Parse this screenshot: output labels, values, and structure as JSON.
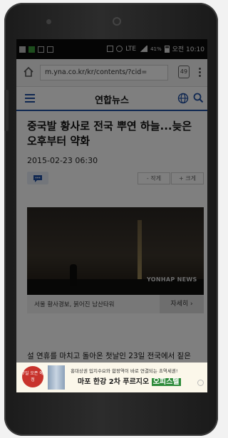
{
  "status_bar": {
    "network": "LTE",
    "battery": "41%",
    "time": "오전 10:10"
  },
  "browser": {
    "url": "m.yna.co.kr/kr/contents/?cid=",
    "tab_count": "49"
  },
  "site": {
    "logo": "연합뉴스",
    "accent_color": "#1e4fa3"
  },
  "article": {
    "headline": "중국발 황사로 전국 뿌연 하늘...늦은 오후부터 약화",
    "date": "2015-02-23 06:30",
    "font_smaller": "- 작게",
    "font_larger": "+ 크게",
    "photo_watermark": "YONHAP NEWS",
    "photo_caption": "서울 황사경보, 붉어진 남산타워",
    "detail_button": "자세히",
    "body_first_line": "설 연휴를 마치고 돌아온 첫날인 23일 전국에서 짙은"
  },
  "ad": {
    "badge_text": "7일 오픈 예정",
    "top_line": "홍대상권 입지수요와 합정역이 바로 연결되는 초역세권!",
    "main_line_prefix": "마포 한강 2차 푸르지오",
    "main_line_highlight": "오피스텔"
  },
  "icons": [
    "home-icon",
    "tab-switcher-icon",
    "overflow-menu-icon",
    "hamburger-menu-icon",
    "globe-icon",
    "search-icon",
    "comment-icon",
    "close-icon"
  ]
}
